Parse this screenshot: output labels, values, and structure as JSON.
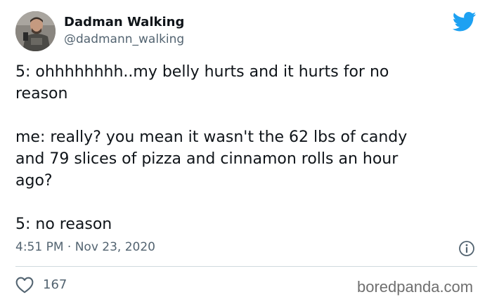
{
  "user": {
    "display_name": "Dadman Walking",
    "handle": "@dadmann_walking"
  },
  "tweet": {
    "paragraphs": [
      "5: ohhhhhhhh..my belly hurts and it hurts for no\nreason",
      "me: really? you mean it wasn't the 62 lbs of candy\nand 79 slices of pizza and cinnamon rolls an hour\nago?",
      "5: no reason"
    ],
    "timestamp": "4:51 PM · Nov 23, 2020"
  },
  "engagement": {
    "likes": "167"
  },
  "watermark": "boredpanda.com",
  "icons": {
    "brand": "twitter-bird-icon",
    "info": "info-icon",
    "like": "heart-icon"
  },
  "colors": {
    "twitter_blue": "#1da1f2",
    "secondary_text": "#536471",
    "primary_text": "#0f1419"
  }
}
